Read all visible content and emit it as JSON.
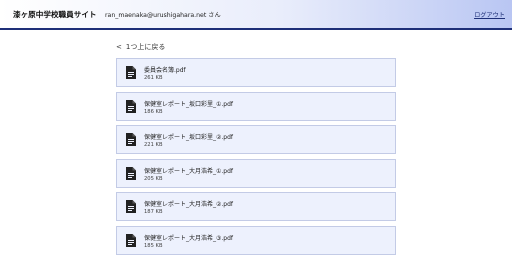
{
  "header": {
    "site_title": "漆ヶ原中学校職員サイト",
    "user_text": "ran_maenaka@urushigahara.net さん",
    "logout_label": "ログアウト"
  },
  "nav": {
    "back_label": "1つ上に戻る"
  },
  "files": [
    {
      "name": "委員会名簿.pdf",
      "size": "261 KB"
    },
    {
      "name": "保健室レポート_坂口彩里_①.pdf",
      "size": "186 KB"
    },
    {
      "name": "保健室レポート_坂口彩里_②.pdf",
      "size": "221 KB"
    },
    {
      "name": "保健室レポート_大月浩希_①.pdf",
      "size": "205 KB"
    },
    {
      "name": "保健室レポート_大月浩希_②.pdf",
      "size": "187 KB"
    },
    {
      "name": "保健室レポート_大月浩希_③.pdf",
      "size": "185 KB"
    }
  ],
  "colors": {
    "header_accent": "#1e2f78",
    "card_bg": "#edf1fd",
    "card_border": "#c3cbe6"
  },
  "icons": {
    "back": "chevron-left-icon",
    "file": "document-icon"
  }
}
